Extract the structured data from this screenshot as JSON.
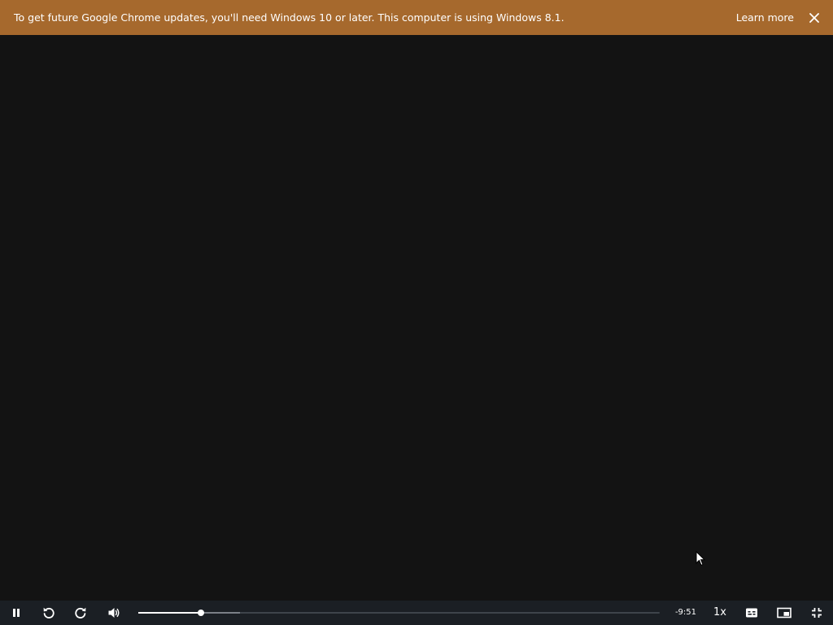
{
  "banner": {
    "message": "To get future Google Chrome updates, you'll need Windows 10 or later. This computer is using Windows 8.1.",
    "learn_more": "Learn more",
    "close_icon": "close-icon",
    "background": "#a6692d"
  },
  "player": {
    "background": "#131313",
    "controls": {
      "play_state_icon": "pause-icon",
      "rewind_icon": "rewind-icon",
      "forward_icon": "forward-icon",
      "volume_icon": "volume-icon",
      "progress": {
        "played_fraction": 0.12,
        "buffered_fraction": 0.195
      },
      "time_remaining": "-9:51",
      "speed": "1x",
      "captions_icon": "captions-icon",
      "pip_icon": "picture-in-picture-icon",
      "exit_fullscreen_icon": "exit-fullscreen-icon"
    }
  }
}
